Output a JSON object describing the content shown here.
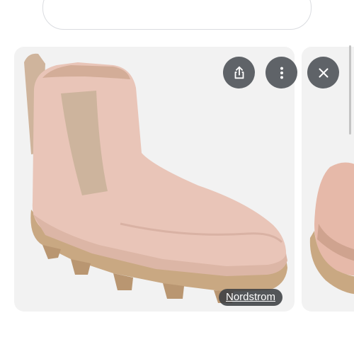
{
  "search": {
    "placeholder": ""
  },
  "viewer": {
    "actions": [
      {
        "name": "share",
        "icon": "share-icon"
      },
      {
        "name": "more-options",
        "icon": "more-vert-icon"
      },
      {
        "name": "close",
        "icon": "close-icon"
      }
    ],
    "image": {
      "subject": "boot-image",
      "source_label": "Nordstrom"
    },
    "next_image": {
      "subject": "boot-image-partial"
    }
  },
  "colors": {
    "card_bg": "#f2f2f2",
    "button_bg": "#5f6368",
    "boot_pink": "#e9c5b8",
    "elastic": "#cdb49d",
    "sole": "#c9a882"
  }
}
